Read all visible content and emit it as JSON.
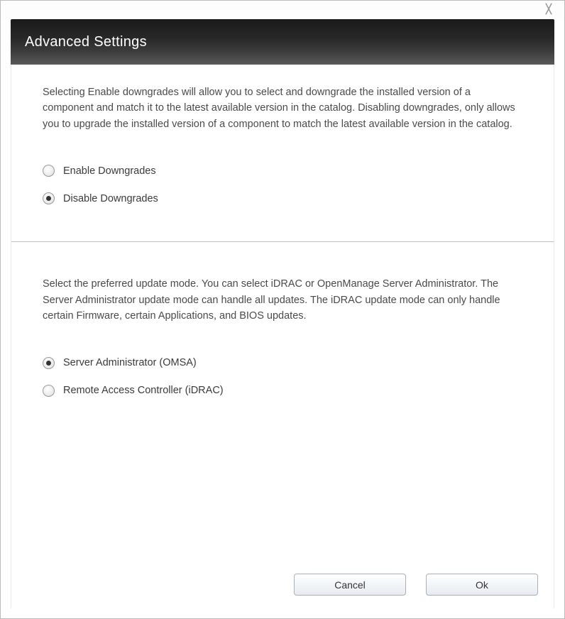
{
  "header": {
    "title": "Advanced Settings"
  },
  "downgrades": {
    "description": "Selecting Enable downgrades will allow you to select and downgrade the installed version of a component and match it to the latest available version in the catalog. Disabling downgrades, only allows you to upgrade the installed version of a component to match the latest available version in the catalog.",
    "options": {
      "enable": "Enable Downgrades",
      "disable": "Disable Downgrades"
    },
    "selected": "disable"
  },
  "update_mode": {
    "description": "Select the preferred update mode. You can select iDRAC or OpenManage Server Administrator. The Server Administrator update mode can handle all updates. The iDRAC update mode can only handle certain Firmware, certain Applications, and BIOS updates.",
    "options": {
      "omsa": "Server Administrator (OMSA)",
      "idrac": "Remote Access Controller (iDRAC)"
    },
    "selected": "omsa"
  },
  "footer": {
    "cancel": "Cancel",
    "ok": "Ok"
  }
}
